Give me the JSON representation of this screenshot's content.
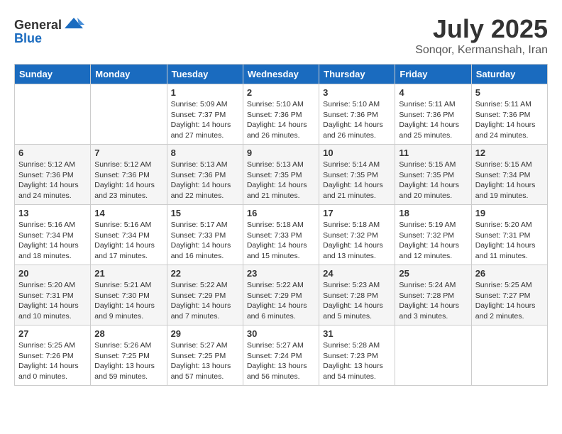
{
  "header": {
    "logo_general": "General",
    "logo_blue": "Blue",
    "month_year": "July 2025",
    "location": "Sonqor, Kermanshah, Iran"
  },
  "days_of_week": [
    "Sunday",
    "Monday",
    "Tuesday",
    "Wednesday",
    "Thursday",
    "Friday",
    "Saturday"
  ],
  "weeks": [
    [
      {
        "day": "",
        "info": ""
      },
      {
        "day": "",
        "info": ""
      },
      {
        "day": "1",
        "sunrise": "5:09 AM",
        "sunset": "7:37 PM",
        "daylight": "14 hours and 27 minutes."
      },
      {
        "day": "2",
        "sunrise": "5:10 AM",
        "sunset": "7:36 PM",
        "daylight": "14 hours and 26 minutes."
      },
      {
        "day": "3",
        "sunrise": "5:10 AM",
        "sunset": "7:36 PM",
        "daylight": "14 hours and 26 minutes."
      },
      {
        "day": "4",
        "sunrise": "5:11 AM",
        "sunset": "7:36 PM",
        "daylight": "14 hours and 25 minutes."
      },
      {
        "day": "5",
        "sunrise": "5:11 AM",
        "sunset": "7:36 PM",
        "daylight": "14 hours and 24 minutes."
      }
    ],
    [
      {
        "day": "6",
        "sunrise": "5:12 AM",
        "sunset": "7:36 PM",
        "daylight": "14 hours and 24 minutes."
      },
      {
        "day": "7",
        "sunrise": "5:12 AM",
        "sunset": "7:36 PM",
        "daylight": "14 hours and 23 minutes."
      },
      {
        "day": "8",
        "sunrise": "5:13 AM",
        "sunset": "7:36 PM",
        "daylight": "14 hours and 22 minutes."
      },
      {
        "day": "9",
        "sunrise": "5:13 AM",
        "sunset": "7:35 PM",
        "daylight": "14 hours and 21 minutes."
      },
      {
        "day": "10",
        "sunrise": "5:14 AM",
        "sunset": "7:35 PM",
        "daylight": "14 hours and 21 minutes."
      },
      {
        "day": "11",
        "sunrise": "5:15 AM",
        "sunset": "7:35 PM",
        "daylight": "14 hours and 20 minutes."
      },
      {
        "day": "12",
        "sunrise": "5:15 AM",
        "sunset": "7:34 PM",
        "daylight": "14 hours and 19 minutes."
      }
    ],
    [
      {
        "day": "13",
        "sunrise": "5:16 AM",
        "sunset": "7:34 PM",
        "daylight": "14 hours and 18 minutes."
      },
      {
        "day": "14",
        "sunrise": "5:16 AM",
        "sunset": "7:34 PM",
        "daylight": "14 hours and 17 minutes."
      },
      {
        "day": "15",
        "sunrise": "5:17 AM",
        "sunset": "7:33 PM",
        "daylight": "14 hours and 16 minutes."
      },
      {
        "day": "16",
        "sunrise": "5:18 AM",
        "sunset": "7:33 PM",
        "daylight": "14 hours and 15 minutes."
      },
      {
        "day": "17",
        "sunrise": "5:18 AM",
        "sunset": "7:32 PM",
        "daylight": "14 hours and 13 minutes."
      },
      {
        "day": "18",
        "sunrise": "5:19 AM",
        "sunset": "7:32 PM",
        "daylight": "14 hours and 12 minutes."
      },
      {
        "day": "19",
        "sunrise": "5:20 AM",
        "sunset": "7:31 PM",
        "daylight": "14 hours and 11 minutes."
      }
    ],
    [
      {
        "day": "20",
        "sunrise": "5:20 AM",
        "sunset": "7:31 PM",
        "daylight": "14 hours and 10 minutes."
      },
      {
        "day": "21",
        "sunrise": "5:21 AM",
        "sunset": "7:30 PM",
        "daylight": "14 hours and 9 minutes."
      },
      {
        "day": "22",
        "sunrise": "5:22 AM",
        "sunset": "7:29 PM",
        "daylight": "14 hours and 7 minutes."
      },
      {
        "day": "23",
        "sunrise": "5:22 AM",
        "sunset": "7:29 PM",
        "daylight": "14 hours and 6 minutes."
      },
      {
        "day": "24",
        "sunrise": "5:23 AM",
        "sunset": "7:28 PM",
        "daylight": "14 hours and 5 minutes."
      },
      {
        "day": "25",
        "sunrise": "5:24 AM",
        "sunset": "7:28 PM",
        "daylight": "14 hours and 3 minutes."
      },
      {
        "day": "26",
        "sunrise": "5:25 AM",
        "sunset": "7:27 PM",
        "daylight": "14 hours and 2 minutes."
      }
    ],
    [
      {
        "day": "27",
        "sunrise": "5:25 AM",
        "sunset": "7:26 PM",
        "daylight": "14 hours and 0 minutes."
      },
      {
        "day": "28",
        "sunrise": "5:26 AM",
        "sunset": "7:25 PM",
        "daylight": "13 hours and 59 minutes."
      },
      {
        "day": "29",
        "sunrise": "5:27 AM",
        "sunset": "7:25 PM",
        "daylight": "13 hours and 57 minutes."
      },
      {
        "day": "30",
        "sunrise": "5:27 AM",
        "sunset": "7:24 PM",
        "daylight": "13 hours and 56 minutes."
      },
      {
        "day": "31",
        "sunrise": "5:28 AM",
        "sunset": "7:23 PM",
        "daylight": "13 hours and 54 minutes."
      },
      {
        "day": "",
        "info": ""
      },
      {
        "day": "",
        "info": ""
      }
    ]
  ],
  "labels": {
    "sunrise_prefix": "Sunrise: ",
    "sunset_prefix": "Sunset: ",
    "daylight_prefix": "Daylight: "
  }
}
